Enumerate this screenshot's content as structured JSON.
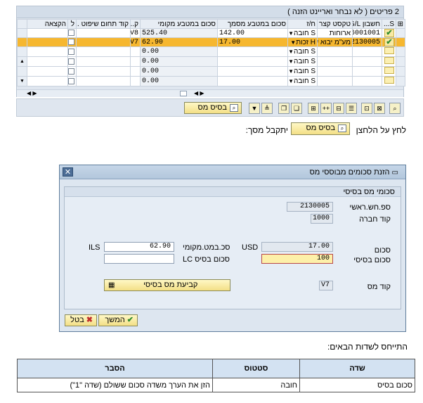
{
  "grid": {
    "title": "2 פריטים ( לא נבחר ואריינט הזנה )",
    "headers": [
      "S...",
      "חשבון G/L",
      "טקסט קצר",
      "ח/ז",
      "סכום במטבע מסמך",
      "סכום במטבע מקומי",
      "ק...",
      "קוד תחום שיפוט ...",
      "ל",
      "הקצאה"
    ],
    "rows": [
      {
        "account": "6001001",
        "text": "ארוחות",
        "dc": "S חובה",
        "doc_amount": "142.00",
        "local_amount": "525.40",
        "tax": "V8"
      },
      {
        "account": "2130005",
        "text": "מע\"מ יבוא ש",
        "dc": "H זכות",
        "doc_amount": "17.00",
        "local_amount": "62.90",
        "tax": "V7"
      },
      {
        "account": "",
        "text": "",
        "dc": "S חובה",
        "doc_amount": "",
        "local_amount": "0.00",
        "tax": ""
      },
      {
        "account": "",
        "text": "",
        "dc": "S חובה",
        "doc_amount": "",
        "local_amount": "0.00",
        "tax": ""
      },
      {
        "account": "",
        "text": "",
        "dc": "S חובה",
        "doc_amount": "",
        "local_amount": "0.00",
        "tax": ""
      },
      {
        "account": "",
        "text": "",
        "dc": "S חובה",
        "doc_amount": "",
        "local_amount": "0.00",
        "tax": ""
      }
    ]
  },
  "toolbar": {
    "basis_button": "בסיס מס",
    "icons": [
      "zoom-icon",
      "filter-icon",
      "sort-icon",
      "copy-icon",
      "paste-icon",
      "insert-icon",
      "delete-icon",
      "select-all-icon",
      "deselect-icon",
      "details-icon",
      "find-icon"
    ]
  },
  "instruction": {
    "before": "לחץ על הלחצן",
    "button": "בסיס מס",
    "after": "יתקבל מסך:"
  },
  "dialog": {
    "title": "הזנת סכומים מבוססי מס",
    "frame_title": "סכומי מס בסיסי",
    "labels": {
      "gl": "ספ.חש.ראשי",
      "company": "קוד חברה",
      "amount": "סכום",
      "basis": "סכום בסיסי",
      "local": "סכ.במט.מקומי",
      "lc_basis": "סכום בסיס LC",
      "tax_code": "קוד מס"
    },
    "values": {
      "gl": "2130005",
      "company": "1000",
      "amount": "17.00",
      "amount_currency": "USD",
      "basis": "100",
      "local": "62.90",
      "local_currency": "ILS",
      "lc_basis": "",
      "tax_code": "V7"
    },
    "determine_button": "קביעת מס בסיסי",
    "continue_button": "המשך",
    "cancel_button": "בטל"
  },
  "refer": "התייחס לשדות הבאים:",
  "fields_table": {
    "headers": [
      "שדה",
      "סטטוס",
      "הסבר"
    ],
    "rows": [
      [
        "סכום בסיס",
        "חובה",
        "הזן את הערך משדה סכום ששולם (שדה \"1\")"
      ]
    ]
  }
}
